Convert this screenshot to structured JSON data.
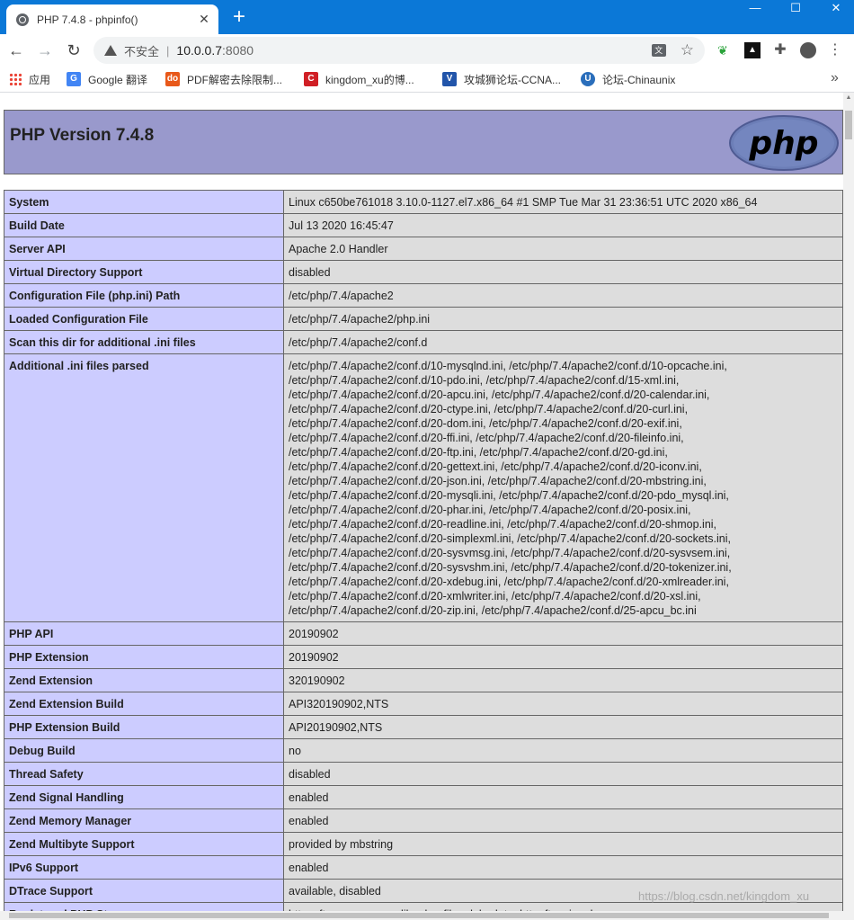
{
  "browser": {
    "tab_title": "PHP 7.4.8 - phpinfo()",
    "security_label": "不安全",
    "url_host": "10.0.0.7",
    "url_port": ":8080",
    "bookmarks": [
      {
        "label": "应用",
        "icon": "apps-grid-icon"
      },
      {
        "label": "Google 翻译",
        "icon": "google-translate-icon",
        "color": "#4285f4"
      },
      {
        "label": "PDF解密去除限制...",
        "icon": "pdf-icon",
        "color": "#e8591a"
      },
      {
        "label": "kingdom_xu的博...",
        "icon": "csdn-icon",
        "color": "#d01f25"
      },
      {
        "label": "攻城狮论坛-CCNA...",
        "icon": "vs-icon",
        "color": "#2255aa"
      },
      {
        "label": "论坛-Chinaunix",
        "icon": "chinaunix-icon",
        "color": "#2a6ebb"
      }
    ]
  },
  "page": {
    "heading": "PHP Version 7.4.8",
    "logo_text": "php",
    "rows": [
      {
        "key": "System",
        "value": "Linux c650be761018 3.10.0-1127.el7.x86_64 #1 SMP Tue Mar 31 23:36:51 UTC 2020 x86_64"
      },
      {
        "key": "Build Date",
        "value": "Jul 13 2020 16:45:47"
      },
      {
        "key": "Server API",
        "value": "Apache 2.0 Handler"
      },
      {
        "key": "Virtual Directory Support",
        "value": "disabled"
      },
      {
        "key": "Configuration File (php.ini) Path",
        "value": "/etc/php/7.4/apache2"
      },
      {
        "key": "Loaded Configuration File",
        "value": "/etc/php/7.4/apache2/php.ini"
      },
      {
        "key": "Scan this dir for additional .ini files",
        "value": "/etc/php/7.4/apache2/conf.d"
      }
    ],
    "ini_files_key": "Additional .ini files parsed",
    "ini_files_lines": [
      "/etc/php/7.4/apache2/conf.d/10-mysqlnd.ini, /etc/php/7.4/apache2/conf.d/10-opcache.ini,",
      "/etc/php/7.4/apache2/conf.d/10-pdo.ini, /etc/php/7.4/apache2/conf.d/15-xml.ini,",
      "/etc/php/7.4/apache2/conf.d/20-apcu.ini, /etc/php/7.4/apache2/conf.d/20-calendar.ini,",
      "/etc/php/7.4/apache2/conf.d/20-ctype.ini, /etc/php/7.4/apache2/conf.d/20-curl.ini,",
      "/etc/php/7.4/apache2/conf.d/20-dom.ini, /etc/php/7.4/apache2/conf.d/20-exif.ini,",
      "/etc/php/7.4/apache2/conf.d/20-ffi.ini, /etc/php/7.4/apache2/conf.d/20-fileinfo.ini,",
      "/etc/php/7.4/apache2/conf.d/20-ftp.ini, /etc/php/7.4/apache2/conf.d/20-gd.ini,",
      "/etc/php/7.4/apache2/conf.d/20-gettext.ini, /etc/php/7.4/apache2/conf.d/20-iconv.ini,",
      "/etc/php/7.4/apache2/conf.d/20-json.ini, /etc/php/7.4/apache2/conf.d/20-mbstring.ini,",
      "/etc/php/7.4/apache2/conf.d/20-mysqli.ini, /etc/php/7.4/apache2/conf.d/20-pdo_mysql.ini,",
      "/etc/php/7.4/apache2/conf.d/20-phar.ini, /etc/php/7.4/apache2/conf.d/20-posix.ini,",
      "/etc/php/7.4/apache2/conf.d/20-readline.ini, /etc/php/7.4/apache2/conf.d/20-shmop.ini,",
      "/etc/php/7.4/apache2/conf.d/20-simplexml.ini, /etc/php/7.4/apache2/conf.d/20-sockets.ini,",
      "/etc/php/7.4/apache2/conf.d/20-sysvmsg.ini, /etc/php/7.4/apache2/conf.d/20-sysvsem.ini,",
      "/etc/php/7.4/apache2/conf.d/20-sysvshm.ini, /etc/php/7.4/apache2/conf.d/20-tokenizer.ini,",
      "/etc/php/7.4/apache2/conf.d/20-xdebug.ini, /etc/php/7.4/apache2/conf.d/20-xmlreader.ini,",
      "/etc/php/7.4/apache2/conf.d/20-xmlwriter.ini, /etc/php/7.4/apache2/conf.d/20-xsl.ini,",
      "/etc/php/7.4/apache2/conf.d/20-zip.ini, /etc/php/7.4/apache2/conf.d/25-apcu_bc.ini"
    ],
    "rows2": [
      {
        "key": "PHP API",
        "value": "20190902"
      },
      {
        "key": "PHP Extension",
        "value": "20190902"
      },
      {
        "key": "Zend Extension",
        "value": "320190902"
      },
      {
        "key": "Zend Extension Build",
        "value": "API320190902,NTS"
      },
      {
        "key": "PHP Extension Build",
        "value": "API20190902,NTS"
      },
      {
        "key": "Debug Build",
        "value": "no"
      },
      {
        "key": "Thread Safety",
        "value": "disabled"
      },
      {
        "key": "Zend Signal Handling",
        "value": "enabled"
      },
      {
        "key": "Zend Memory Manager",
        "value": "enabled"
      },
      {
        "key": "Zend Multibyte Support",
        "value": "provided by mbstring"
      },
      {
        "key": "IPv6 Support",
        "value": "enabled"
      },
      {
        "key": "DTrace Support",
        "value": "available, disabled"
      },
      {
        "key": "Registered PHP Streams",
        "value": "https, ftps, compress.zlib, php, file, glob, data, http, ftp, zip, phar"
      }
    ],
    "watermark": "https://blog.csdn.net/kingdom_xu"
  },
  "colors": {
    "titlebar": "#0b78d7",
    "header_bg": "#9999cc",
    "key_cell_bg": "#ccccff",
    "value_cell_bg": "#dddddd",
    "logo_bg": "#6c7eb7"
  }
}
